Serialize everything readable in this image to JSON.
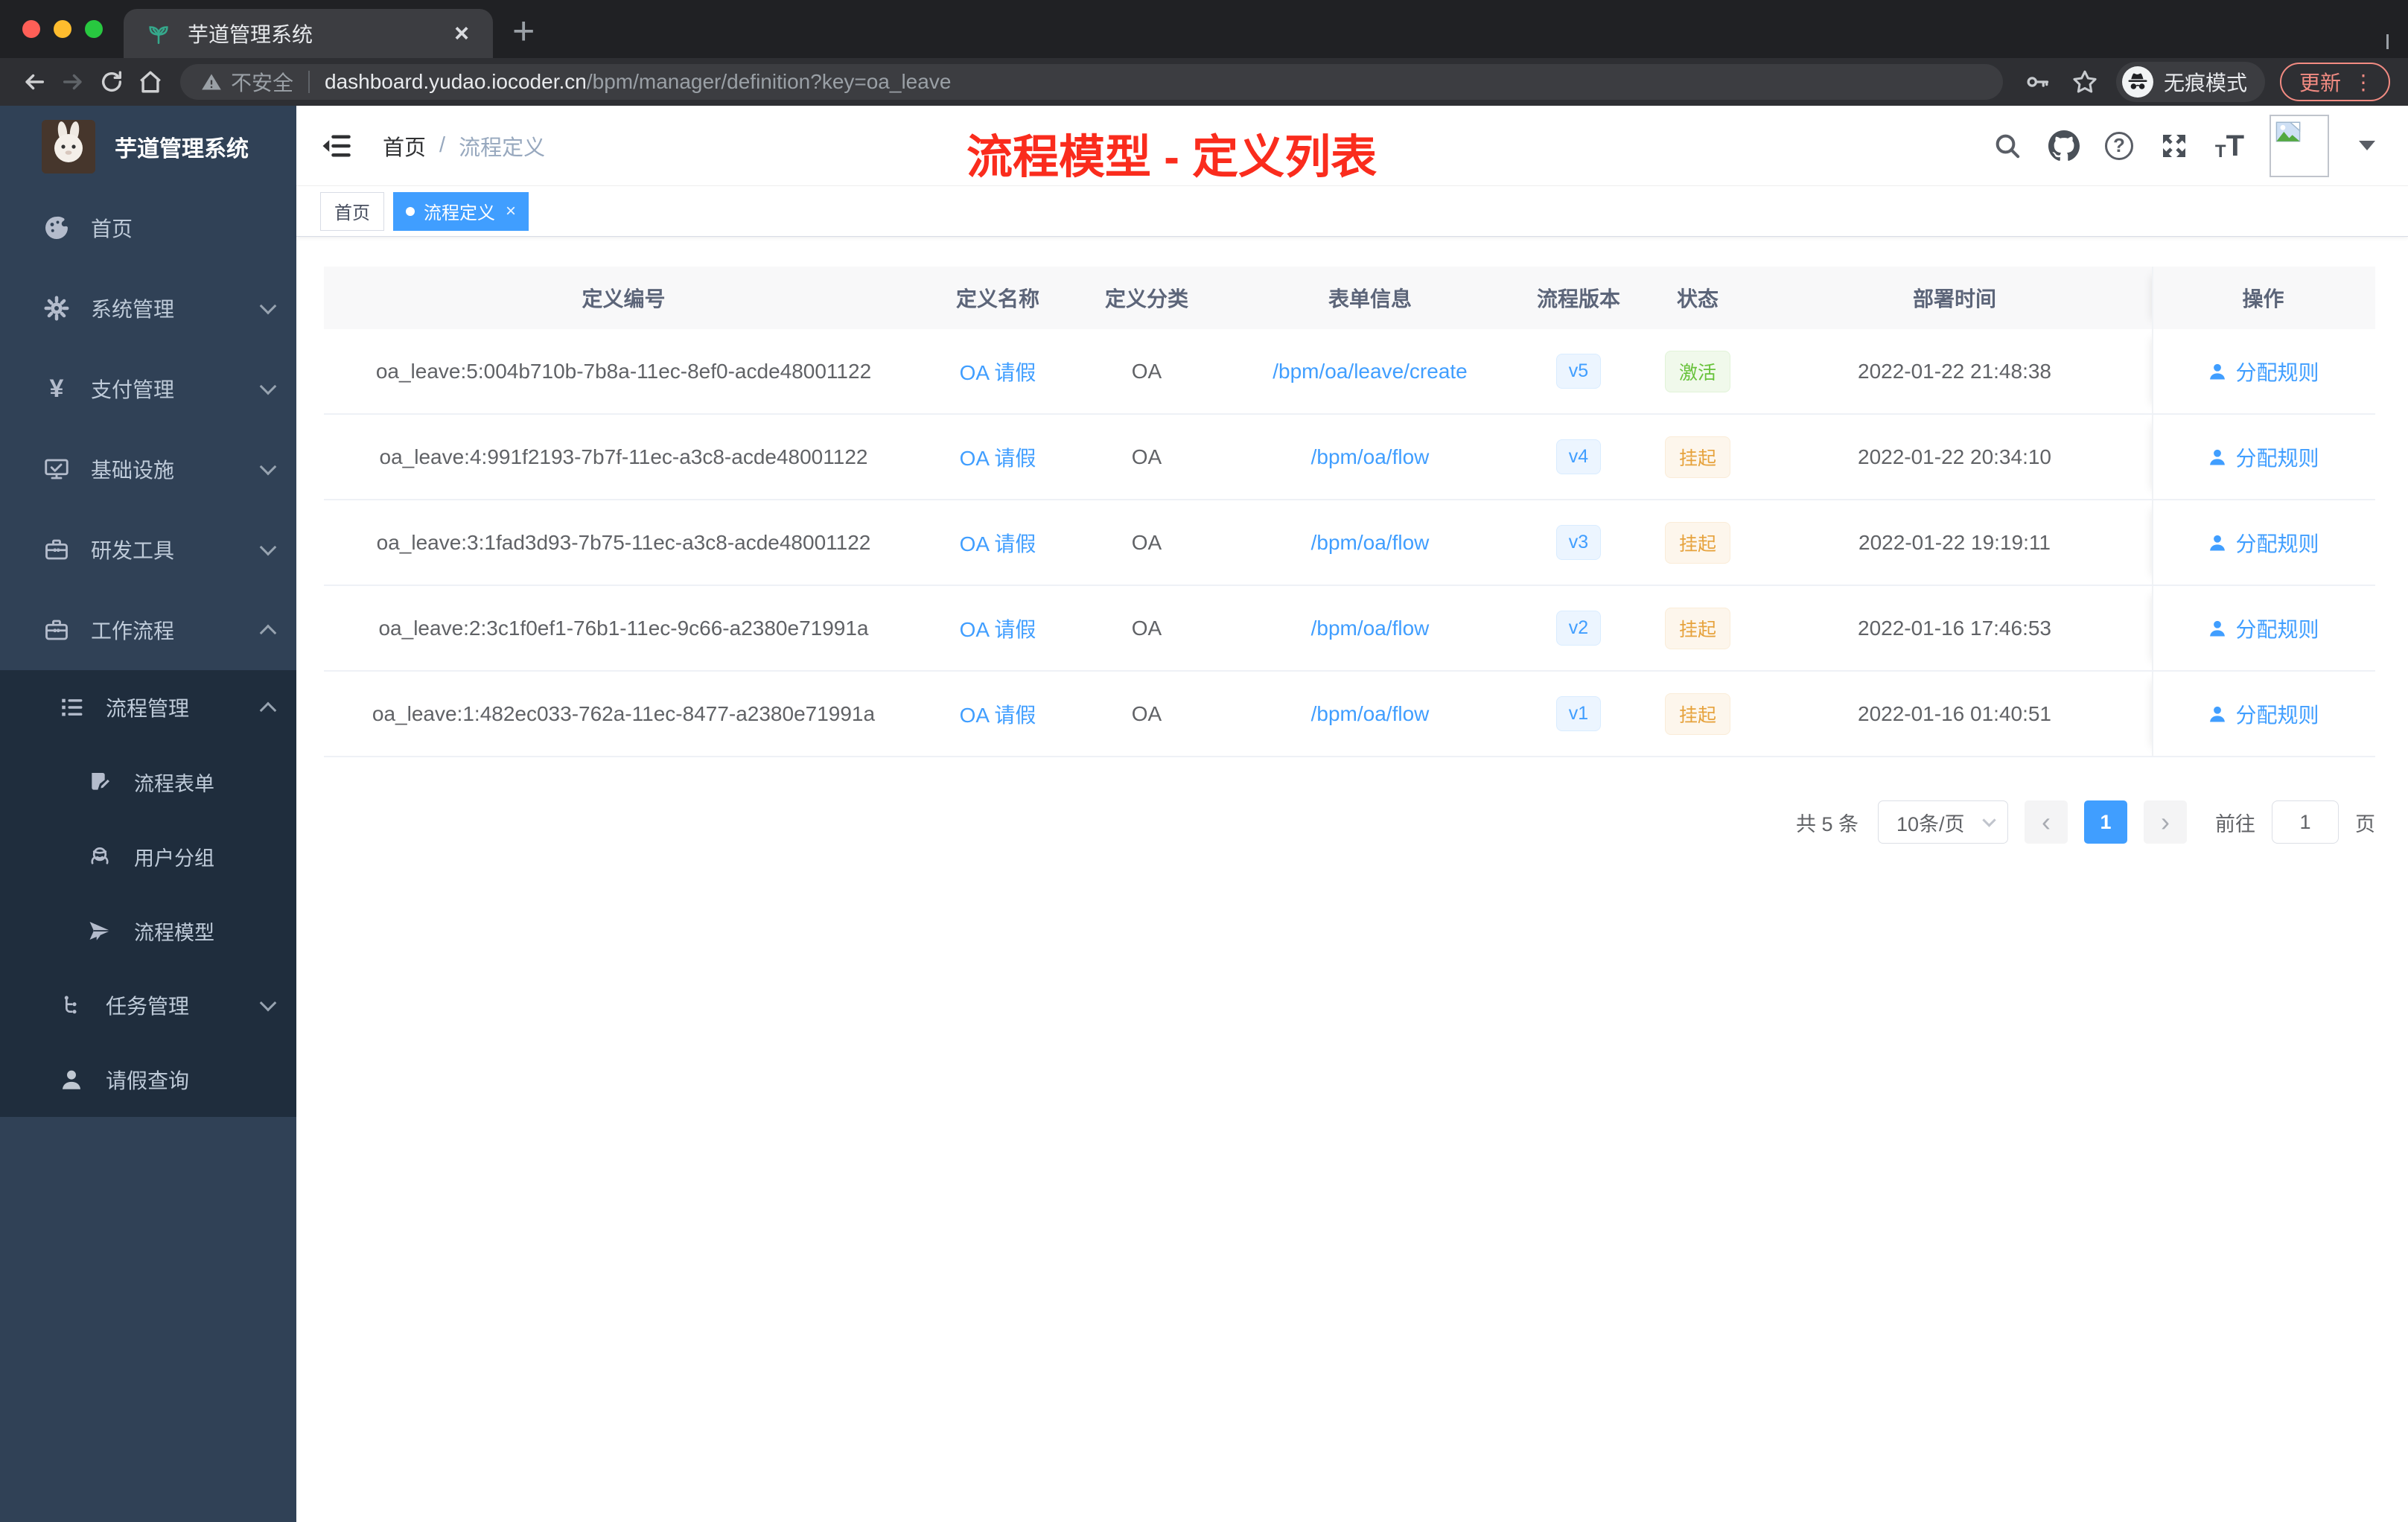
{
  "browser": {
    "tab": {
      "title": "芋道管理系统",
      "close": "×",
      "new_tab": "+"
    },
    "toolbar": {
      "security_label": "不安全",
      "url_host": "dashboard.yudao.iocoder.cn",
      "url_path": "/bpm/manager/definition?key=oa_leave",
      "incognito_label": "无痕模式",
      "update_label": "更新",
      "menu_dots": "⋮"
    }
  },
  "annotation": {
    "text": "流程模型 - 定义列表",
    "color": "#fa2c1d"
  },
  "sidebar": {
    "logo_title": "芋道管理系统",
    "items": [
      {
        "label": "首页"
      },
      {
        "label": "系统管理"
      },
      {
        "label": "支付管理"
      },
      {
        "label": "基础设施"
      },
      {
        "label": "研发工具"
      },
      {
        "label": "工作流程"
      },
      {
        "label": "流程管理"
      },
      {
        "label": "流程表单"
      },
      {
        "label": "用户分组"
      },
      {
        "label": "流程模型"
      },
      {
        "label": "任务管理"
      },
      {
        "label": "请假查询"
      }
    ]
  },
  "header": {
    "breadcrumb": {
      "home": "首页",
      "sep": "/",
      "current": "流程定义"
    }
  },
  "tags": {
    "home": "首页",
    "active": "流程定义",
    "close": "×"
  },
  "table": {
    "columns": [
      "定义编号",
      "定义名称",
      "定义分类",
      "表单信息",
      "流程版本",
      "状态",
      "部署时间",
      "操作"
    ],
    "rows": [
      {
        "id": "oa_leave:5:004b710b-7b8a-11ec-8ef0-acde48001122",
        "name": "OA 请假",
        "category": "OA",
        "form": "/bpm/oa/leave/create",
        "version": "v5",
        "status": "激活",
        "status_type": "active",
        "deploy_time": "2022-01-22 21:48:38",
        "action": "分配规则"
      },
      {
        "id": "oa_leave:4:991f2193-7b7f-11ec-a3c8-acde48001122",
        "name": "OA 请假",
        "category": "OA",
        "form": "/bpm/oa/flow",
        "version": "v4",
        "status": "挂起",
        "status_type": "suspended",
        "deploy_time": "2022-01-22 20:34:10",
        "action": "分配规则"
      },
      {
        "id": "oa_leave:3:1fad3d93-7b75-11ec-a3c8-acde48001122",
        "name": "OA 请假",
        "category": "OA",
        "form": "/bpm/oa/flow",
        "version": "v3",
        "status": "挂起",
        "status_type": "suspended",
        "deploy_time": "2022-01-22 19:19:11",
        "action": "分配规则"
      },
      {
        "id": "oa_leave:2:3c1f0ef1-76b1-11ec-9c66-a2380e71991a",
        "name": "OA 请假",
        "category": "OA",
        "form": "/bpm/oa/flow",
        "version": "v2",
        "status": "挂起",
        "status_type": "suspended",
        "deploy_time": "2022-01-16 17:46:53",
        "action": "分配规则"
      },
      {
        "id": "oa_leave:1:482ec033-762a-11ec-8477-a2380e71991a",
        "name": "OA 请假",
        "category": "OA",
        "form": "/bpm/oa/flow",
        "version": "v1",
        "status": "挂起",
        "status_type": "suspended",
        "deploy_time": "2022-01-16 01:40:51",
        "action": "分配规则"
      }
    ]
  },
  "pagination": {
    "total": "共 5 条",
    "page_size": "10条/页",
    "prev": "‹",
    "current_page": "1",
    "next": "›",
    "goto_label": "前往",
    "goto_value": "1",
    "page_unit": "页"
  },
  "colors": {
    "primary": "#409eff",
    "success": "#67c23a",
    "warning": "#e6a23c",
    "sidebar_bg": "#304156",
    "submenu_bg": "#1f2d3d"
  }
}
